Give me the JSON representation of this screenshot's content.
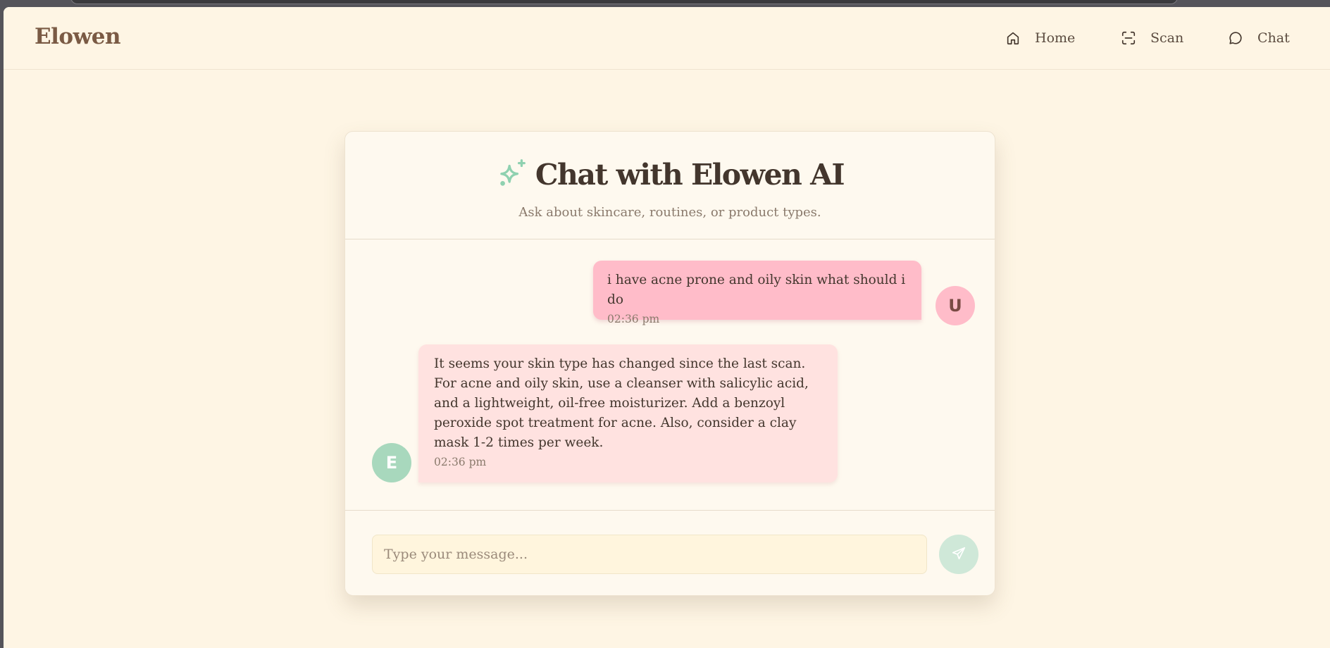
{
  "app": {
    "brand": "Elowen"
  },
  "nav": {
    "items": [
      {
        "label": "Home",
        "icon": "home-icon"
      },
      {
        "label": "Scan",
        "icon": "scan-icon"
      },
      {
        "label": "Chat",
        "icon": "chat-bubble-icon"
      }
    ]
  },
  "chat": {
    "title": "Chat with Elowen AI",
    "title_icon": "sparkles-icon",
    "subtitle": "Ask about skincare, routines, or product types.",
    "messages": [
      {
        "sender": "user",
        "avatar": "U",
        "text": "i have acne prone and oily skin what should i do",
        "time": "02:36 pm"
      },
      {
        "sender": "ai",
        "avatar": "E",
        "text": "It seems your skin type has changed since the last scan. For acne and oily skin, use a cleanser with salicylic acid, and a lightweight, oil-free moisturizer. Add a benzoyl peroxide spot treatment for acne. Also, consider a clay mask 1-2 times per week.",
        "time": "02:36 pm"
      }
    ],
    "input": {
      "placeholder": "Type your message...",
      "value": ""
    },
    "send_icon": "send-icon"
  },
  "colors": {
    "page_background": "#fef5e4",
    "brand": "#7a5a44",
    "user_bubble": "#ffbcc9",
    "ai_bubble": "#ffe2e0",
    "ai_avatar": "#a8d8bd",
    "accent_green": "#8fd1b0",
    "send_button": "#cfe8d8"
  }
}
